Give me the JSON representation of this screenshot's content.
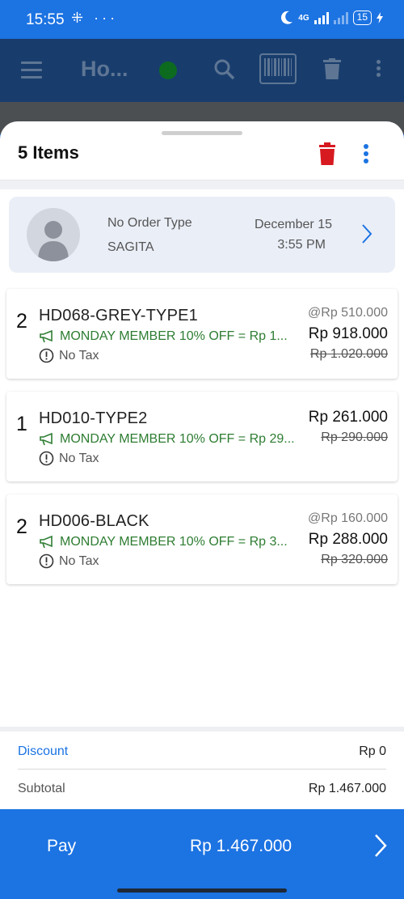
{
  "status_bar": {
    "time": "15:55",
    "left_icons": "⁜ ···",
    "network": "4G",
    "battery": "15"
  },
  "app_bar": {
    "title": "Ho...",
    "status_color": "#0c6b1f"
  },
  "sheet": {
    "title": "5 Items"
  },
  "customer": {
    "order_type": "No Order Type",
    "name": "SAGITA",
    "date": "December 15",
    "time": "3:55 PM"
  },
  "items": [
    {
      "qty": "2",
      "name": "HD068-GREY-TYPE1",
      "promo": "MONDAY MEMBER 10% OFF = Rp 1...",
      "tax": "No Tax",
      "unit_price": "@Rp 510.000",
      "total": "Rp 918.000",
      "original": "Rp 1.020.000"
    },
    {
      "qty": "1",
      "name": "HD010-TYPE2",
      "promo": "MONDAY MEMBER 10% OFF = Rp 29...",
      "tax": "No Tax",
      "unit_price": "",
      "total": "Rp 261.000",
      "original": "Rp 290.000"
    },
    {
      "qty": "2",
      "name": "HD006-BLACK",
      "promo": "MONDAY MEMBER 10% OFF = Rp 3...",
      "tax": "No Tax",
      "unit_price": "@Rp 160.000",
      "total": "Rp 288.000",
      "original": "Rp 320.000"
    }
  ],
  "summary": {
    "discount_label": "Discount",
    "discount_value": "Rp 0",
    "subtotal_label": "Subtotal",
    "subtotal_value": "Rp 1.467.000"
  },
  "pay_bar": {
    "label": "Pay",
    "total": "Rp 1.467.000"
  },
  "colors": {
    "accent": "#1c73e2",
    "delete": "#d71920",
    "promo": "#2e7d32"
  },
  "icons": [
    "menu-icon",
    "search-icon",
    "barcode-icon",
    "trash-icon",
    "more-vert-icon",
    "chevron-right-icon",
    "megaphone-icon",
    "info-circle-icon",
    "person-icon"
  ]
}
